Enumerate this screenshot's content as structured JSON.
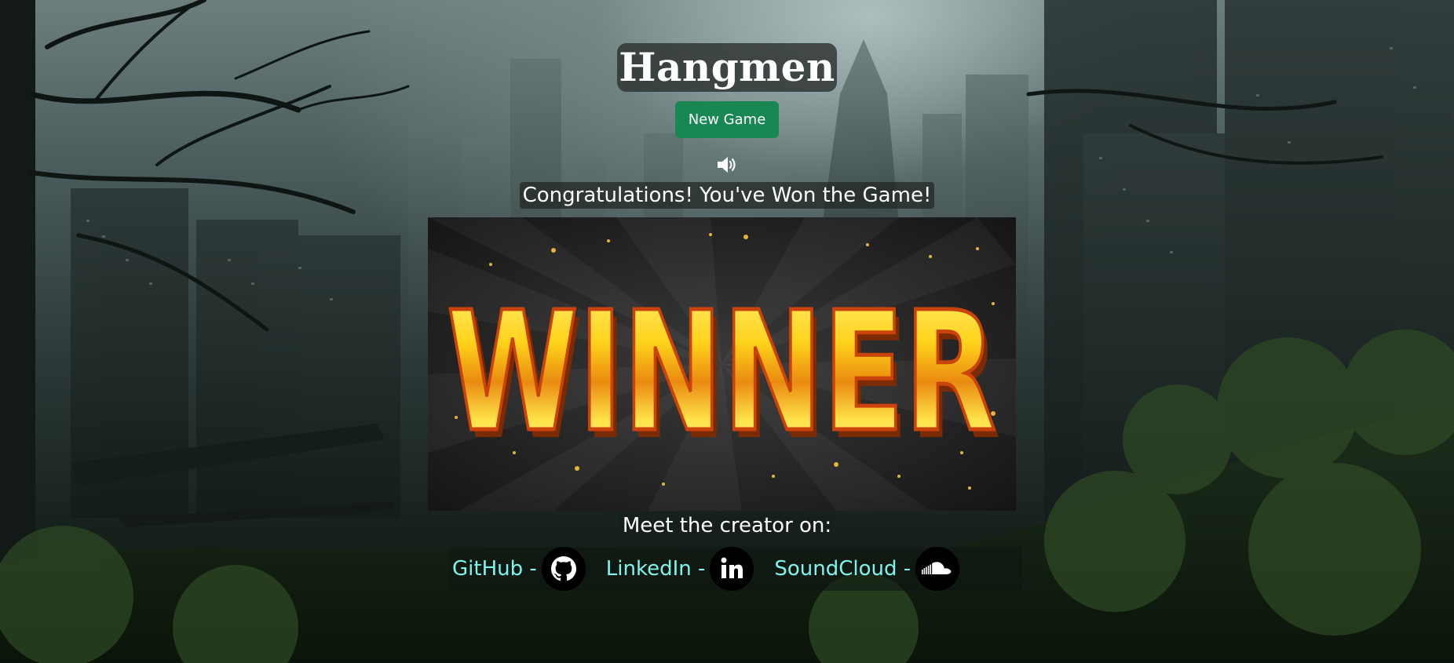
{
  "header": {
    "title": "Hangmen",
    "new_game_label": "New Game",
    "sound_icon": "speaker-volume-icon"
  },
  "result": {
    "message": "Congratulations! You've Won the Game!",
    "banner_text": "WINNER"
  },
  "footer": {
    "meet_label": "Meet the creator on:",
    "links": [
      {
        "label": "GitHub -",
        "icon": "github-icon"
      },
      {
        "label": "LinkedIn -",
        "icon": "linkedin-icon"
      },
      {
        "label": "SoundCloud -",
        "icon": "soundcloud-icon"
      }
    ]
  },
  "colors": {
    "button": "#198754",
    "link_text": "#7ff3ee",
    "winner_gold": "#ffd21a",
    "winner_outline": "#c9430a"
  }
}
